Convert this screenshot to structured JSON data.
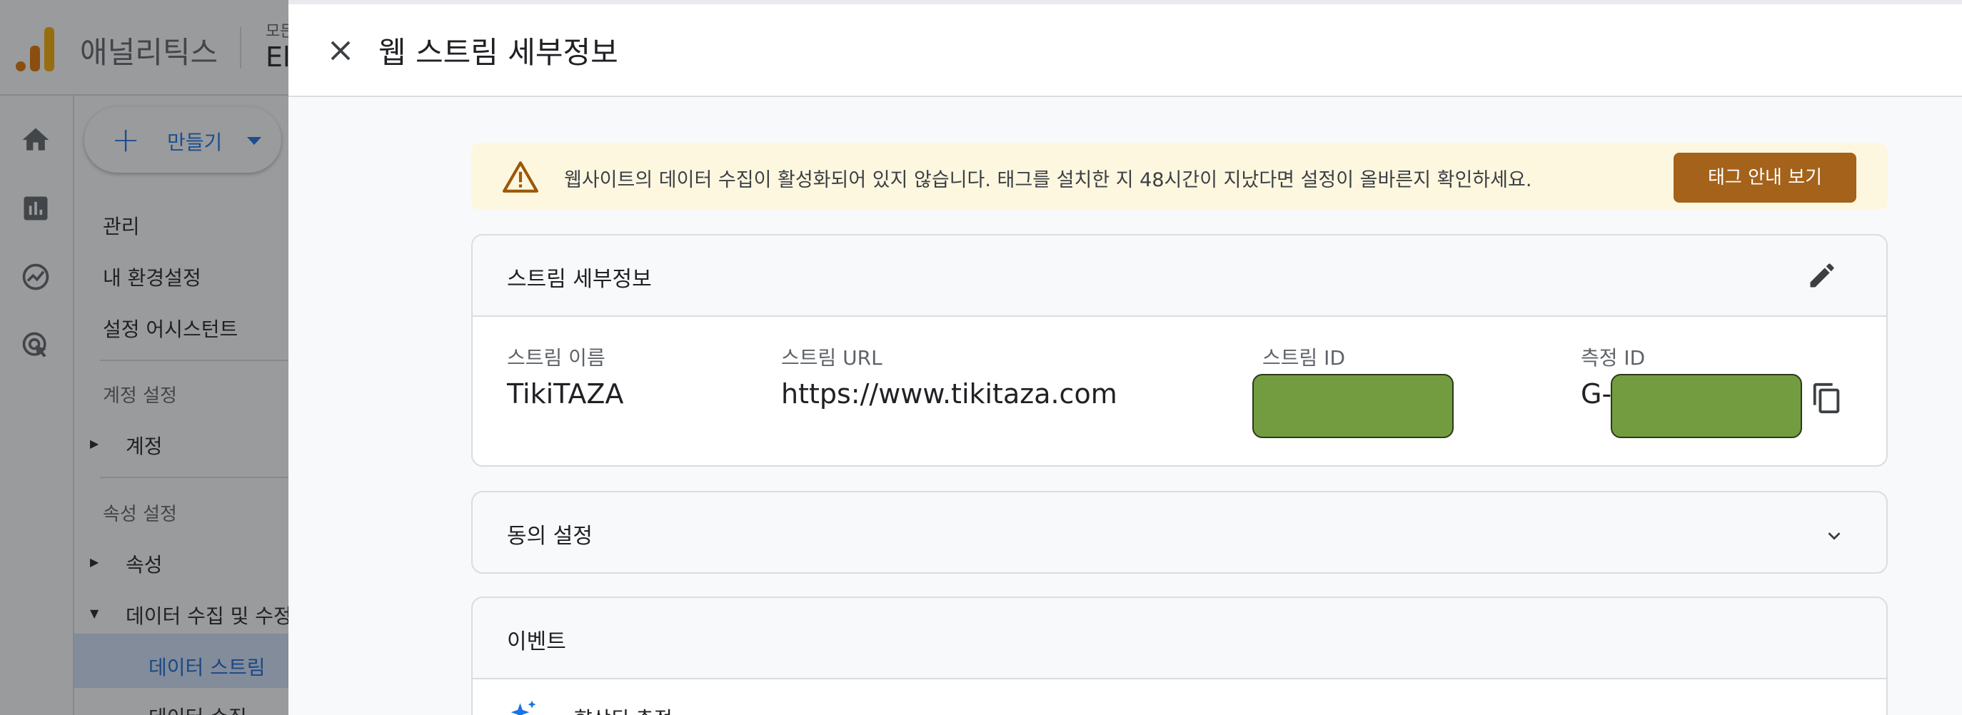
{
  "app": {
    "name": "애널리틱스",
    "account_small": "모든",
    "account_big": "El"
  },
  "nav": {
    "create_label": "만들기",
    "items": {
      "admin": "관리",
      "preferences": "내 환경설정",
      "setup_assistant": "설정 어시스턴트",
      "account_settings_header": "계정 설정",
      "account": "계정",
      "property_settings_header": "속성 설정",
      "property": "속성",
      "data_collection": "데이터 수집 및 수정",
      "data_streams": "데이터 스트림",
      "data_collect_partial": "데이터 수집"
    }
  },
  "panel": {
    "title": "웹 스트림 세부정보",
    "banner": {
      "message": "웹사이트의 데이터 수집이 활성화되어 있지 않습니다. 태그를 설치한 지 48시간이 지났다면 설정이 올바른지 확인하세요.",
      "button_label": "태그 안내 보기"
    },
    "stream_details": {
      "title": "스트림 세부정보",
      "name_label": "스트림 이름",
      "name_value": "TikiTAZA",
      "url_label": "스트림 URL",
      "url_value": "https://www.tikitaza.com",
      "id_label": "스트림 ID",
      "measurement_label": "측정 ID",
      "measurement_prefix": "G-"
    },
    "consent": {
      "title": "동의 설정"
    },
    "events": {
      "title": "이벤트",
      "enhanced_measurement_partial": "향상된 측정"
    }
  },
  "colors": {
    "accent": "#1a73e8",
    "banner_bg": "#fef7e0",
    "banner_button": "#a4621a",
    "redaction": "#739c40"
  },
  "icons": {
    "close": "close-icon",
    "warning": "warning-icon",
    "edit": "pencil-icon",
    "copy": "copy-icon",
    "expand": "chevron-down-icon"
  }
}
